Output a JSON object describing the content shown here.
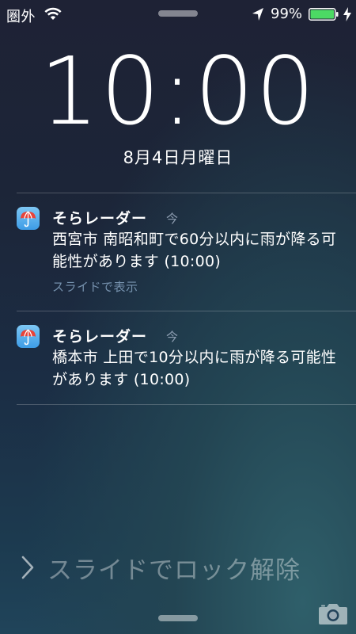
{
  "status_bar": {
    "carrier": "圏外",
    "battery_percent": "99%",
    "icons": [
      "wifi-icon",
      "location-arrow-icon",
      "battery-icon",
      "charging-bolt-icon"
    ]
  },
  "lock_screen": {
    "time": "10:00",
    "date": "8月4日月曜日",
    "unlock_hint": "スライドでロック解除"
  },
  "notifications": [
    {
      "app_name": "そらレーダー",
      "time": "今",
      "body": "西宮市 南昭和町で60分以内に雨が降る可能性があります (10:00)",
      "action": "スライドで表示",
      "icon": "umbrella-app-icon"
    },
    {
      "app_name": "そらレーダー",
      "time": "今",
      "body": "橋本市 上田で10分以内に雨が降る可能性があります (10:00)",
      "action": "",
      "icon": "umbrella-app-icon"
    }
  ],
  "colors": {
    "battery_green": "#4cd964",
    "app_icon_blue": "#3d9ce6",
    "umbrella_red": "#e8443a"
  }
}
